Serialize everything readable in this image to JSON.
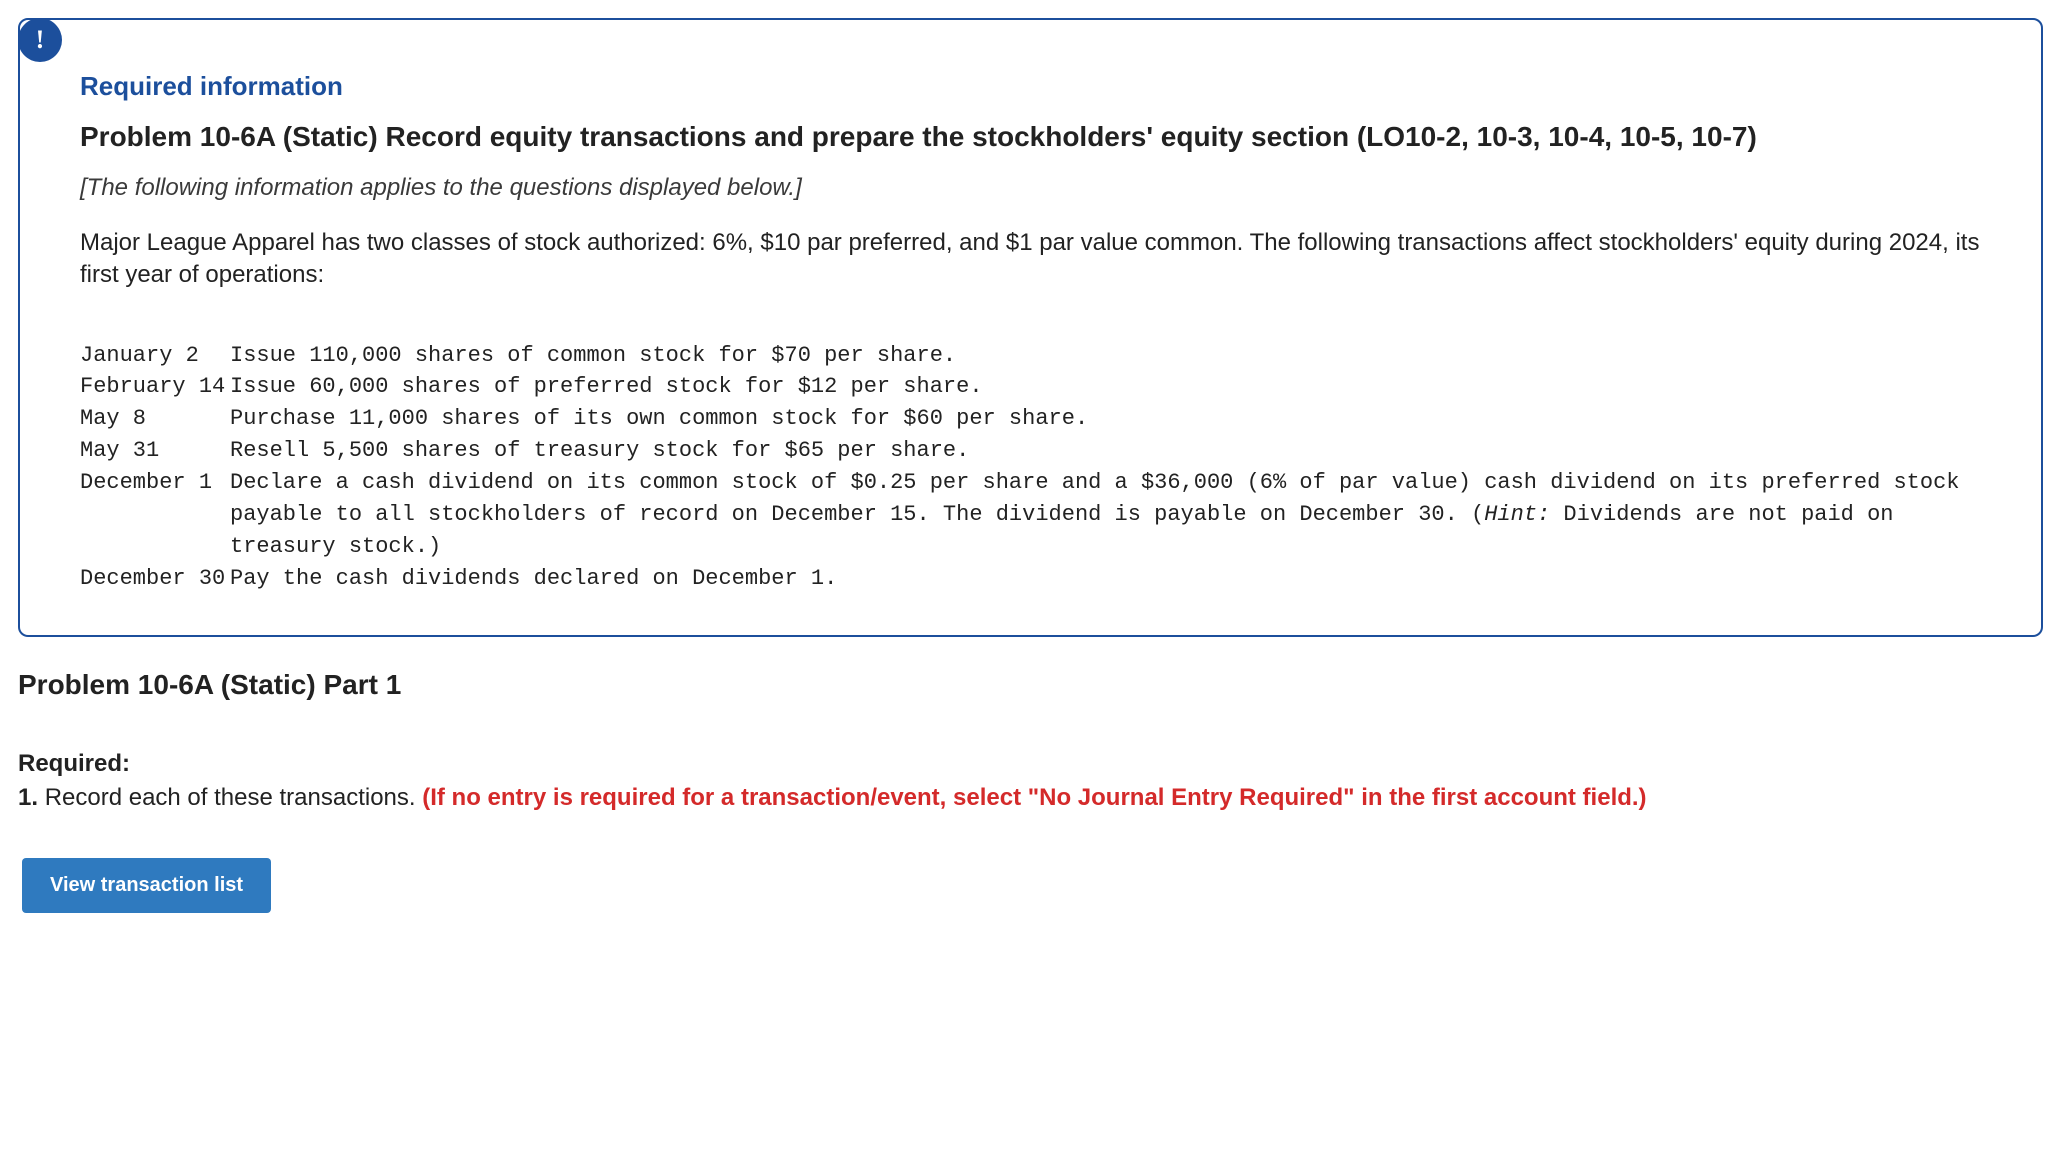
{
  "badge": "!",
  "req_heading": "Required information",
  "problem_title": "Problem 10-6A (Static) Record equity transactions and prepare the stockholders' equity section (LO10-2, 10-3, 10-4, 10-5, 10-7)",
  "instruction_line": "[The following information applies to the questions displayed below.]",
  "narrative": "Major League Apparel has two classes of stock authorized: 6%, $10 par preferred, and $1 par value common. The following transactions affect stockholders' equity during 2024, its first year of operations:",
  "transactions": [
    {
      "date": "January 2",
      "desc_plain": "Issue 110,000 shares of common stock for $70 per share."
    },
    {
      "date": "February 14",
      "desc_plain": "Issue 60,000 shares of preferred stock for $12 per share."
    },
    {
      "date": "May 8",
      "desc_plain": "Purchase 11,000 shares of its own common stock for $60 per share."
    },
    {
      "date": "May 31",
      "desc_plain": "Resell 5,500 shares of treasury stock for $65 per share."
    },
    {
      "date": "December 1",
      "desc_pre": "Declare a cash dividend on its common stock of $0.25 per share and a $36,000 (6% of par value) cash dividend on its preferred stock payable to all stockholders of record on December 15. The dividend is payable on December 30. (",
      "hint": "Hint:",
      "desc_post": " Dividends are not paid on treasury stock.)"
    },
    {
      "date": "December 30",
      "desc_plain": "Pay the cash dividends declared on December 1."
    }
  ],
  "part_title": "Problem 10-6A (Static) Part 1",
  "required_label": "Required:",
  "req_item_number": "1. ",
  "req_item_text": "Record each of these transactions. ",
  "req_item_red": "(If no entry is required for a transaction/event, select \"No Journal Entry Required\" in the first account field.)",
  "view_btn": "View transaction list"
}
